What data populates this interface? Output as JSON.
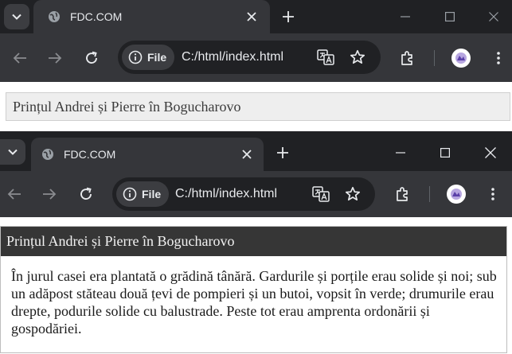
{
  "browser_back": {
    "tab": {
      "title": "FDC.COM",
      "favicon": "globe-icon",
      "close_icon": "close-icon"
    },
    "toolbar": {
      "chip_label": "File",
      "url": "C:/html/index.html",
      "icons": [
        "back-arrow-icon",
        "forward-arrow-icon",
        "reload-icon",
        "info-icon",
        "translate-icon",
        "star-icon",
        "extensions-icon",
        "avatar",
        "menu-icon"
      ]
    }
  },
  "browser_front": {
    "tab": {
      "title": "FDC.COM",
      "favicon": "globe-icon",
      "close_icon": "close-icon"
    },
    "toolbar": {
      "chip_label": "File",
      "url": "C:/html/index.html"
    }
  },
  "page_back": {
    "heading": "Prințul Andrei și Pierre în Bogucharovo"
  },
  "page_front": {
    "heading": "Prințul Andrei și Pierre în Bogucharovo",
    "body": "În jurul casei era plantată o grădină tânără. Gardurile și porțile erau solide și noi; sub un adăpost stăteau două țevi de pompieri și un butoi, vopsit în verde; drumurile erau drepte, podurile solide cu balustrade. Peste tot erau amprenta ordonării și gospodăriei."
  },
  "colors": {
    "tabbar_bg": "#202124",
    "toolbar_bg": "#35363a",
    "omnibox_bg": "#202124",
    "chrome_text": "#e8eaed",
    "heading_plain_bg": "#eeeeee",
    "panel_header_bg": "#363636"
  }
}
